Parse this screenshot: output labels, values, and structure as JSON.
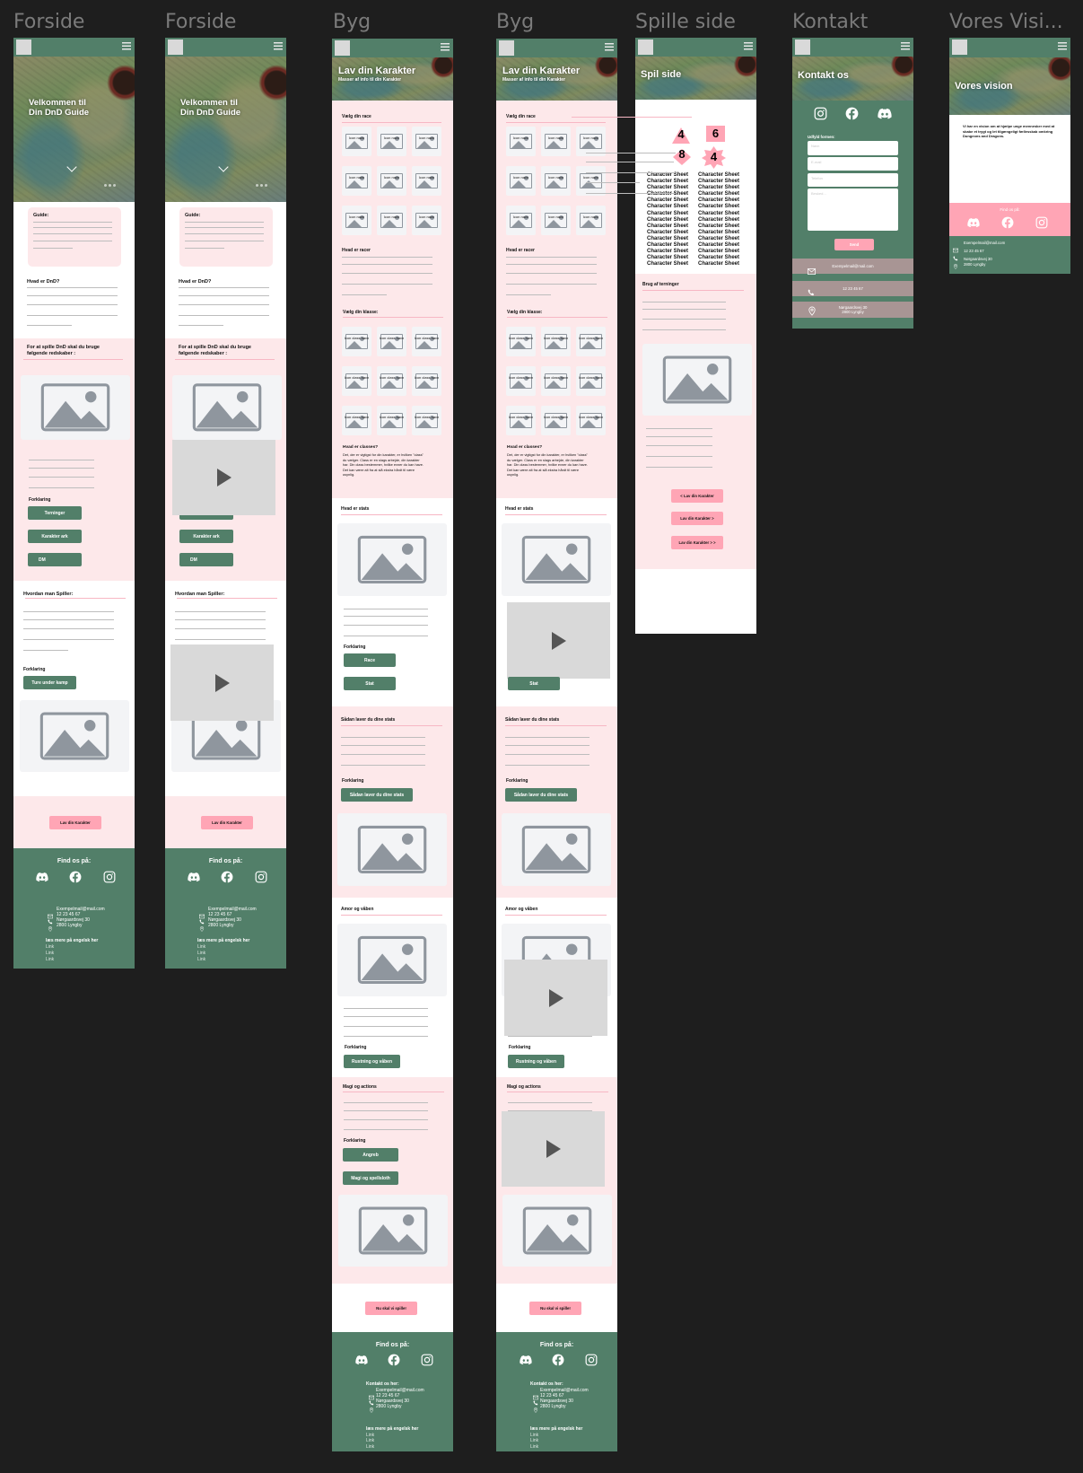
{
  "canvas": {
    "frame_titles": [
      "Forside",
      "Forside",
      "Byg",
      "Byg",
      "Spille side",
      "Kontakt",
      "Vores Visi..."
    ]
  },
  "colors": {
    "brand_green": "#527f69",
    "light_pink": "#fde8ea",
    "button_pink": "#ffa5b5",
    "contact_row": "#a89594",
    "canvas_bg": "#1e1e1e"
  },
  "forside": {
    "hero_title_1": "Velkommen til",
    "hero_title_2": "Din DnD Guide",
    "guide_title": "Guide:",
    "what_title": "Hvad er DnD?",
    "tools_title_1": "For at spille DnD skal du bruge",
    "tools_title_2": "følgende redskaber :",
    "explain": "Forklaring",
    "buttons": [
      "Terninger",
      "Karakter ark",
      "DM"
    ],
    "how_title": "Hvordan man Spiller:",
    "how_button": "Ture under kamp",
    "cta": "Lav din Karakter"
  },
  "footer": {
    "find": "Find os på:",
    "contact_title": "Kontakt os her:",
    "email": "Exempelmail@mail.com",
    "phone": "12 23 45 67",
    "address_1": "Nørgaardsvej 30",
    "address_2": "2800 Lyngby",
    "more": "læs mere på engelsk her",
    "links": [
      "Link",
      "Link",
      "Link"
    ]
  },
  "byg": {
    "hero_title": "Lav din Karakter",
    "hero_sub": "Masser af info til din Karakter",
    "race_title": "Vælg din race",
    "race_tile": "Icon navn",
    "racer_title": "Hvad er racer",
    "class_title": "Vælg din klasse:",
    "class_tile": "Icon class navn",
    "classes_title": "Hvad er classes?",
    "classes_text": "Det, der er vigtigst for din karakter, er hvilken \"class\" du vælger. Class er en slags arbejde, din karakter har. Din class bestemmer, hvilke evner du kan have. Det kan være alt fra at slå ekstra hårdt til være usynlig.",
    "stats_title": "Hvad er stats",
    "explain": "Forklaring",
    "race_button": "Race",
    "stat_button": "Stat",
    "make_stats_title": "Sådan laver du dine stats",
    "make_stats_button": "Sådan laver du dine stats",
    "armor_title": "Amor og våben",
    "armor_button": "Rustning og våben",
    "magic_title": "Magi og actions",
    "attack_button": "Angreb",
    "magic_button": "Magi og spellsloth",
    "cta": "Nu skal vi spille!"
  },
  "spil": {
    "hero_title": "Spil side",
    "dice": [
      "4",
      "6",
      "8",
      "4"
    ],
    "sheet_label": "Character Sheet",
    "dice_title": "Brug af terninger",
    "buttons": [
      "< Lav din Karakter",
      "Lav din Karakter >",
      "Lav din Karakter > >"
    ]
  },
  "kontakt": {
    "hero_title": "Kontakt os",
    "form_title": "Udfyld formen:",
    "name_placeholder": "Navn",
    "email_placeholder": "E-mail",
    "phone_placeholder": "Telefon",
    "message_placeholder": "Besked...",
    "send": "Send",
    "email": "Exempelmail@mail.com",
    "phone": "12 23 45 67",
    "address_1": "Nørgaardsvej 30",
    "address_2": "2800 Lyngby"
  },
  "vision": {
    "hero_title": "Vores vision",
    "text": "Vi har en vision om at hjælpe unge mennesker med at skabe et trygt og let tilgængeligt fællesskab omkring Dungeons and Dragons.",
    "find": "Find os på:",
    "email": "Exempelmail@mail.com",
    "phone": "12 23 45 67",
    "address_1": "Nørgaardsvej 30",
    "address_2": "2800 Lyngby"
  }
}
